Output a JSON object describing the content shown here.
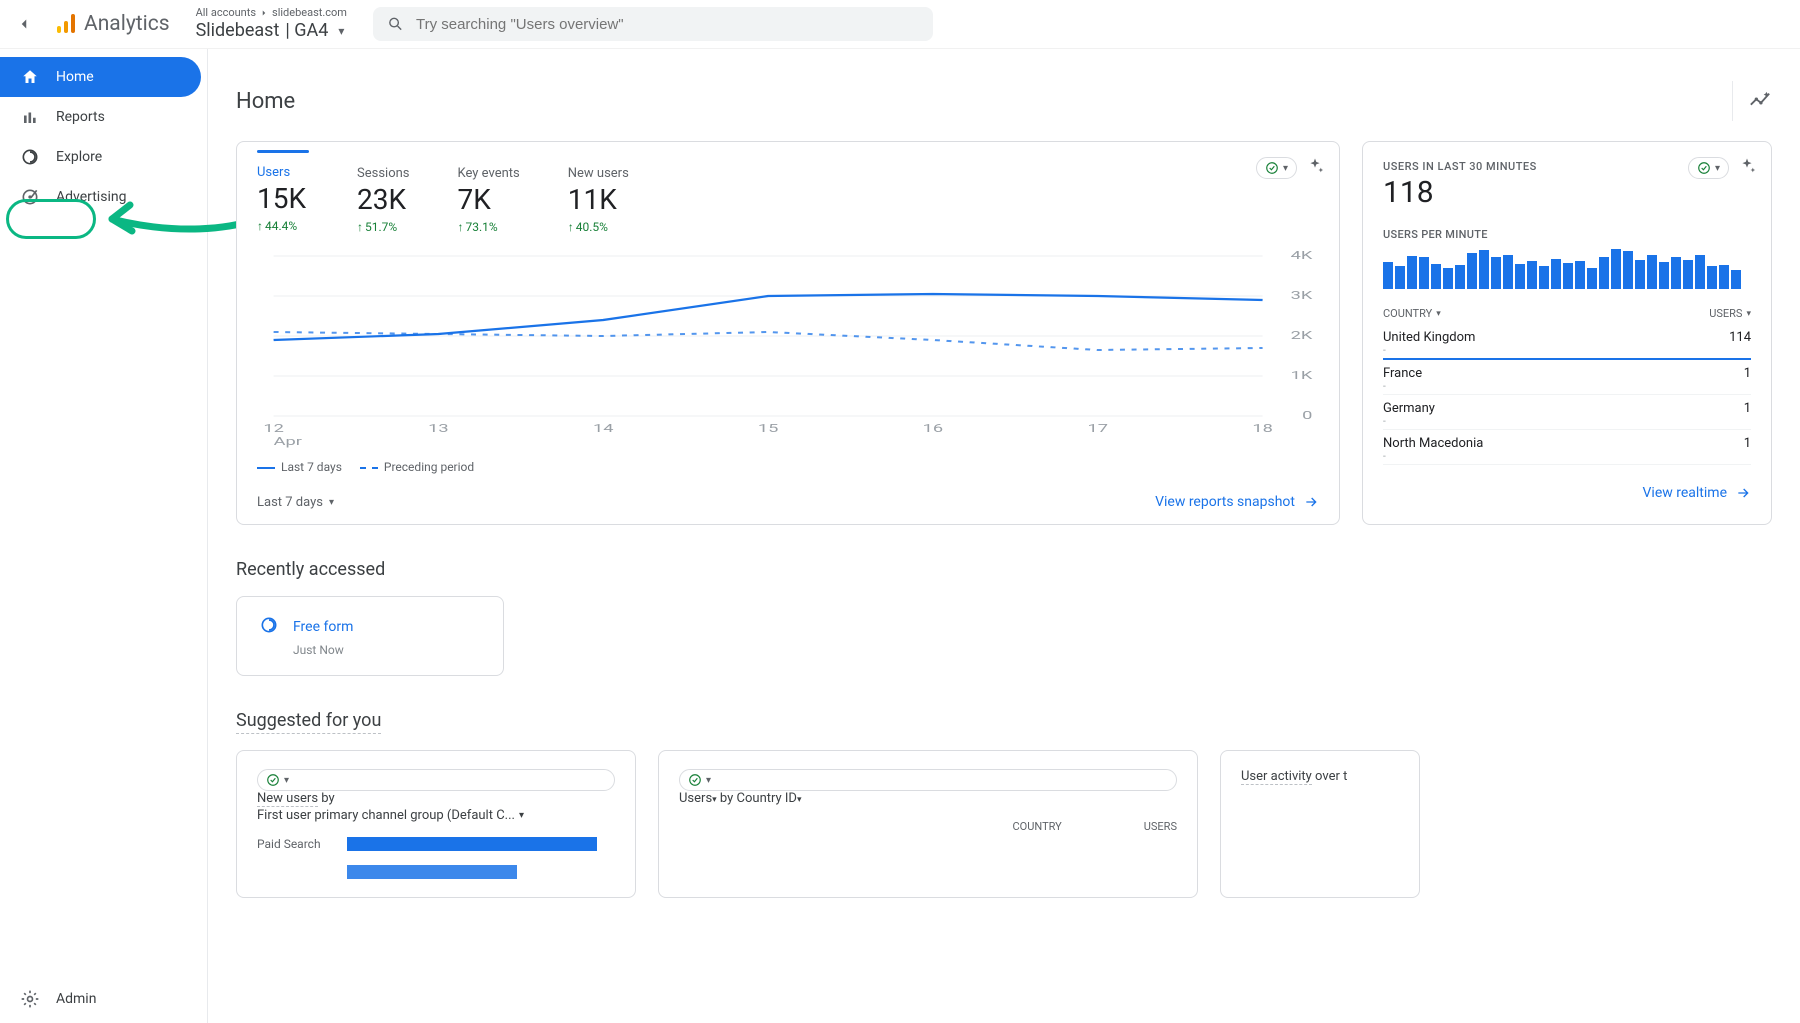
{
  "header": {
    "product": "Analytics",
    "crumb_root": "All accounts",
    "crumb_domain": "slidebeast.com",
    "property": "Slidebeast",
    "property_suffix": "| GA4",
    "search_placeholder": "Try searching \"Users overview\""
  },
  "nav": {
    "home": "Home",
    "reports": "Reports",
    "explore": "Explore",
    "advertising": "Advertising",
    "admin": "Admin"
  },
  "page": {
    "title": "Home"
  },
  "overview": {
    "metrics": [
      {
        "label": "Users",
        "value": "15K",
        "delta": "44.4%"
      },
      {
        "label": "Sessions",
        "value": "23K",
        "delta": "51.7%"
      },
      {
        "label": "Key events",
        "value": "7K",
        "delta": "73.1%"
      },
      {
        "label": "New users",
        "value": "11K",
        "delta": "40.5%"
      }
    ],
    "legend_main": "Last 7 days",
    "legend_prev": "Preceding period",
    "date_range": "Last 7 days",
    "footer_link": "View reports snapshot"
  },
  "chart_data": {
    "type": "line",
    "x_labels": [
      "12",
      "13",
      "14",
      "15",
      "16",
      "17",
      "18"
    ],
    "x_month": "Apr",
    "ylim": [
      0,
      4000
    ],
    "yticks": [
      0,
      1000,
      2000,
      3000,
      4000
    ],
    "ytick_labels": [
      "0",
      "1K",
      "2K",
      "3K",
      "4K"
    ],
    "series": [
      {
        "name": "Last 7 days",
        "style": "solid",
        "values": [
          1900,
          2050,
          2400,
          3000,
          3050,
          3000,
          2900
        ]
      },
      {
        "name": "Preceding period",
        "style": "dashed",
        "values": [
          2100,
          2050,
          2000,
          2100,
          1900,
          1650,
          1700
        ]
      }
    ]
  },
  "realtime": {
    "title": "USERS IN LAST 30 MINUTES",
    "count": "118",
    "per_minute_label": "USERS PER MINUTE",
    "bars": [
      68,
      56,
      82,
      80,
      62,
      52,
      60,
      88,
      96,
      78,
      84,
      62,
      70,
      58,
      74,
      64,
      70,
      52,
      78,
      98,
      94,
      72,
      84,
      68,
      78,
      72,
      84,
      58,
      60,
      46
    ],
    "col_country": "COUNTRY",
    "col_users": "USERS",
    "rows": [
      {
        "country": "United Kingdom",
        "users": "114"
      },
      {
        "country": "France",
        "users": "1"
      },
      {
        "country": "Germany",
        "users": "1"
      },
      {
        "country": "North Macedonia",
        "users": "1"
      }
    ],
    "footer_link": "View realtime"
  },
  "recent": {
    "title": "Recently accessed",
    "item_name": "Free form",
    "item_when": "Just Now"
  },
  "suggested": {
    "title": "Suggested for you",
    "card1": {
      "line1_a": "New users",
      "line1_b": " by",
      "line2": "First user primary channel group (Default C...",
      "bar_label": "Paid Search"
    },
    "card2": {
      "users": "Users",
      "by": " by ",
      "country": "Country ID",
      "col_country": "COUNTRY",
      "col_users": "USERS"
    },
    "card3": {
      "a": "User activity",
      "b": " over t"
    }
  }
}
